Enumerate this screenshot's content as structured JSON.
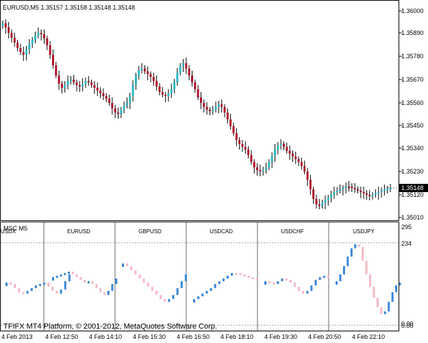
{
  "main": {
    "header": "EURUSD,M5  1.35157 1.35158 1.35148 1.35148",
    "price_labels": [
      "1.36000",
      "1.35890",
      "1.35780",
      "1.35670",
      "1.35560",
      "1.35450",
      "1.35340",
      "1.35230",
      "1.35120",
      "1.35010"
    ],
    "current_price": "1.35148",
    "colors": {
      "bull": "#2ab7c6",
      "bear": "#b0102a",
      "wick": "#000000"
    }
  },
  "indicator": {
    "title": "MSC M5",
    "symbols": [
      "USDX",
      "EURUSD",
      "GBPUSD",
      "USDCAD",
      "USDCHF",
      "USDJPY"
    ],
    "scale_labels": [
      "295",
      "234",
      "0.00",
      "0.00"
    ],
    "copyright": "TFIFX MT4 Platform, © 2001-2012, MetaQuotes Software Corp.",
    "colors": {
      "up": "#3a86d9",
      "down": "#f6b8c4"
    }
  },
  "time_labels": [
    "4 Feb 2013",
    "4 Feb 12:50",
    "4 Feb 14:10",
    "4 Feb 15:30",
    "4 Feb 16:50",
    "4 Feb 18:10",
    "4 Feb 19:30",
    "4 Feb 20:50",
    "4 Feb 22:10"
  ]
}
